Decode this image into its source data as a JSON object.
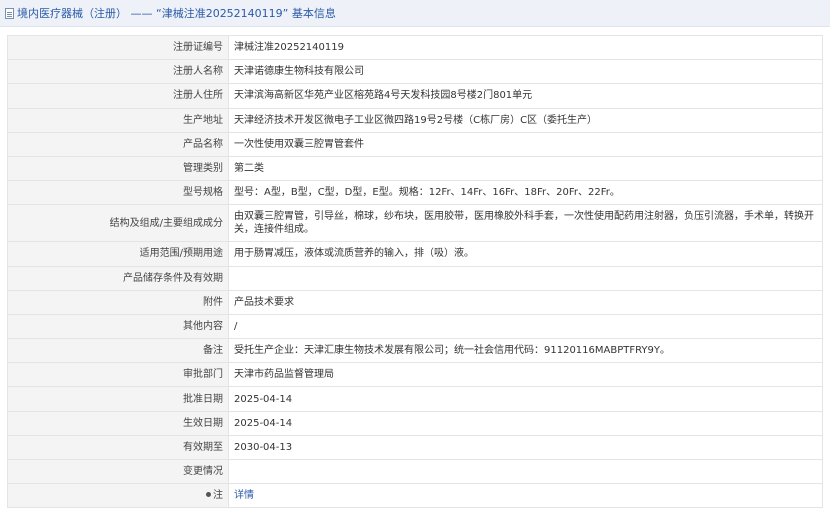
{
  "header": {
    "title": "境内医疗器械（注册） —— “津械注准20252140119” 基本信息"
  },
  "rows": [
    {
      "label": "注册证编号",
      "value": "津械注准20252140119"
    },
    {
      "label": "注册人名称",
      "value": "天津诺德康生物科技有限公司"
    },
    {
      "label": "注册人住所",
      "value": "天津滨海高新区华苑产业区榕苑路4号天发科技园8号楼2门801单元"
    },
    {
      "label": "生产地址",
      "value": "天津经济技术开发区微电子工业区微四路19号2号楼（C栋厂房）C区（委托生产）"
    },
    {
      "label": "产品名称",
      "value": "一次性使用双囊三腔胃管套件"
    },
    {
      "label": "管理类别",
      "value": "第二类"
    },
    {
      "label": "型号规格",
      "value": "型号：A型，B型，C型，D型，E型。规格：12Fr、14Fr、16Fr、18Fr、20Fr、22Fr。"
    },
    {
      "label": "结构及组成/主要组成成分",
      "value": "由双囊三腔胃管，引导丝，棉球，纱布块，医用胶带，医用橡胶外科手套，一次性使用配药用注射器，负压引流器，手术单，转换开关，连接件组成。"
    },
    {
      "label": "适用范围/预期用途",
      "value": "用于肠胃减压，液体或流质营养的输入，排（吸）液。"
    },
    {
      "label": "产品储存条件及有效期",
      "value": ""
    },
    {
      "label": "附件",
      "value": "产品技术要求"
    },
    {
      "label": "其他内容",
      "value": "/"
    },
    {
      "label": "备注",
      "value": "受托生产企业：天津汇康生物技术发展有限公司；统一社会信用代码：91120116MABPTFRY9Y。"
    },
    {
      "label": "审批部门",
      "value": "天津市药品监督管理局"
    },
    {
      "label": "批准日期",
      "value": "2025-04-14"
    },
    {
      "label": "生效日期",
      "value": "2025-04-14"
    },
    {
      "label": "有效期至",
      "value": "2030-04-13"
    },
    {
      "label": "变更情况",
      "value": ""
    }
  ],
  "footer_row": {
    "label": "注",
    "link": "详情",
    "icon": "pin-icon"
  }
}
